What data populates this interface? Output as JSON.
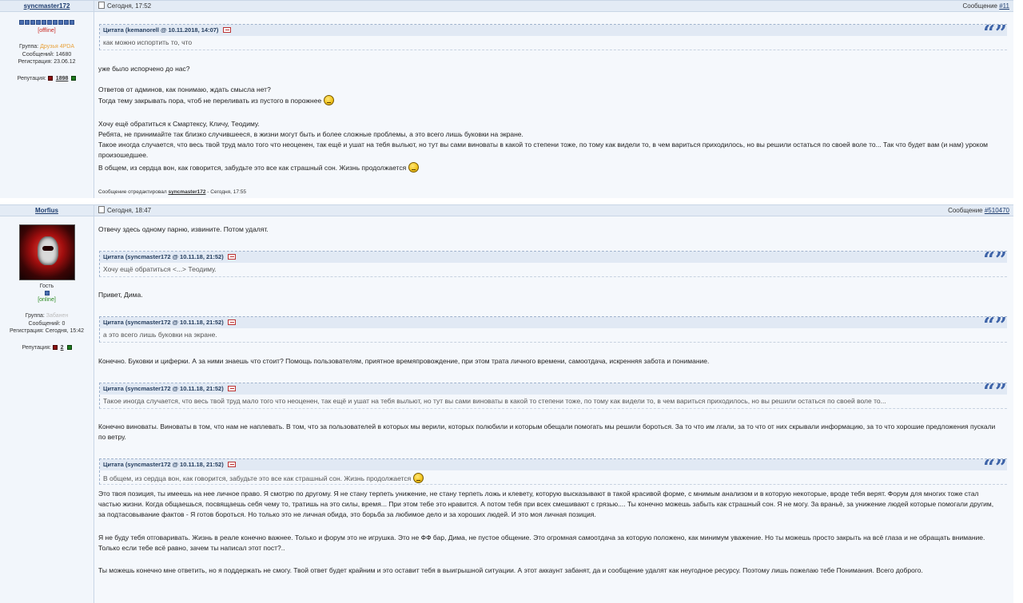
{
  "posts": [
    {
      "author": "syncmaster172",
      "pips": 10,
      "status": "[offline]",
      "group_label": "Группа:",
      "group_value": "Друзья 4PDA",
      "messages": "Сообщений: 14680",
      "registered": "Регистрация: 23.06.12",
      "rep_label": "Репутация:",
      "rep_value": "1898",
      "date": "Сегодня, 17:52",
      "msg_label": "Сообщение ",
      "msg_num": "#11",
      "quotes": [
        {
          "head": "Цитата (kemanorell @ 10.11.2018, 14:07",
          "body": "как можно испортить то, что"
        }
      ],
      "texts": [
        "уже было испорчено до нас?",
        "Ответов от админов, как понимаю, ждать смысла нет?",
        "Тогда тему закрывать пора, чтоб не переливать из пустого в порожнее",
        "Хочу ещё обратиться к Смартексу, Кличу, Теодиму.",
        "Ребята, не принимайте так близко случившееся, в жизни могут быть и более сложные проблемы, а это всего лишь буковки на экране.",
        "Такое иногда случается, что весь твой труд мало того что неоценен, так ещё и ушат на тебя выльют, но тут вы сами виноваты в какой то степени тоже, по тому как видели то, в чем вариться приходилось, но вы решили остаться по своей воле то... Так что будет вам (и нам) уроком произошедшее.",
        "В общем, из сердца вон, как говорится, забудьте это все как страшный сон. Жизнь продолжается"
      ],
      "edited_prefix": "Сообщение отредактировал ",
      "edited_user": "syncmaster172",
      "edited_suffix": " - Сегодня, 17:55"
    },
    {
      "author": "Morfius",
      "guest": "Гость",
      "status": "[online]",
      "group_label": "Группа:",
      "group_value": "Забанен",
      "messages": "Сообщений: 0",
      "registered": "Регистрация: Сегодня, 15:42",
      "rep_label": "Репутация:",
      "rep_value": "2",
      "date": "Сегодня, 18:47",
      "msg_label": "Сообщение ",
      "msg_num": "#510470",
      "quotes": [
        {
          "head": "Цитата (syncmaster172 @ 10.11.18, 21:52",
          "body": "Хочу ещё обратиться <...> Теодиму."
        },
        {
          "head": "Цитата (syncmaster172 @ 10.11.18, 21:52",
          "body": "а это всего лишь буковки на экране."
        },
        {
          "head": "Цитата (syncmaster172 @ 10.11.18, 21:52",
          "body": "Такое иногда случается, что весь твой труд мало того что неоценен, так ещё и ушат на тебя выльют, но тут вы сами виноваты в какой то степени тоже, по тому как видели то, в чем вариться приходилось, но вы решили остаться по своей воле то..."
        },
        {
          "head": "Цитата (syncmaster172 @ 10.11.18, 21:52",
          "body": "В общем, из сердца вон, как говорится, забудьте это все как страшный сон. Жизнь продолжается"
        }
      ],
      "texts": [
        "Отвечу здесь одному парню, извините. Потом удалят.",
        "Привет, Дима.",
        "Конечно. Буковки и циферки. А за ними знаешь что стоит? Помощь пользователям, приятное времяпровождение, при этом трата личного времени, самоотдача, искренняя забота и понимание.",
        "Конечно виноваты. Виноваты в том, что нам не наплевать. В том, что за пользователей в которых мы верили, которых полюбили и которым обещали помогать мы решили бороться. За то что им лгали, за то что от них скрывали информацию, за то что хорошие предложения пускали по ветру.",
        "Это твоя позиция, ты имеешь на нее личное право. Я смотрю по другому. Я не стану терпеть унижение, не стану терпеть ложь и клевету, которую высказывают в такой красивой форме, с мнимым анализом и в которую некоторые, вроде тебя верят. Форум для многих тоже стал частью жизни. Когда общаешься, посвящаешь себя чему то, тратишь на это силы, время... При этом тебе это нравится. А потом тебя при всех смешивают с грязью.... Ты конечно можешь забыть как страшный сон. Я не могу. За враньё, за унижение людей которые помогали другим, за подтасовывание фактов - Я готов бороться. Но только это не личная обида, это борьба за любимое дело и за хороших людей. И это моя личная позиция.",
        "Я не буду тебя отговаривать. Жизнь в реале конечно важнее. Только и форум это не игрушка. Это не ФФ бар, Дима, не пустое общение. Это огромная самоотдача за которую положено, как минимум уважение. Но ты можешь просто закрыть на всё глаза и не обращать внимание. Только если тебе всё равно, зачем ты написал этот пост?..",
        "Ты можешь конечно мне ответить, но я поддержать не смогу. Твой ответ будет крайним и это оставит тебя в выигрышной ситуации. А этот аккаунт забанят, да и сообщение удалят как неугодное ресурсу. Поэтому лишь пожелаю тебе Понимания. Всего доброго."
      ]
    }
  ],
  "icons": {
    "quote": "quote-marks-icon",
    "smiley": "smiley-icon",
    "post_date": "post-icon"
  }
}
